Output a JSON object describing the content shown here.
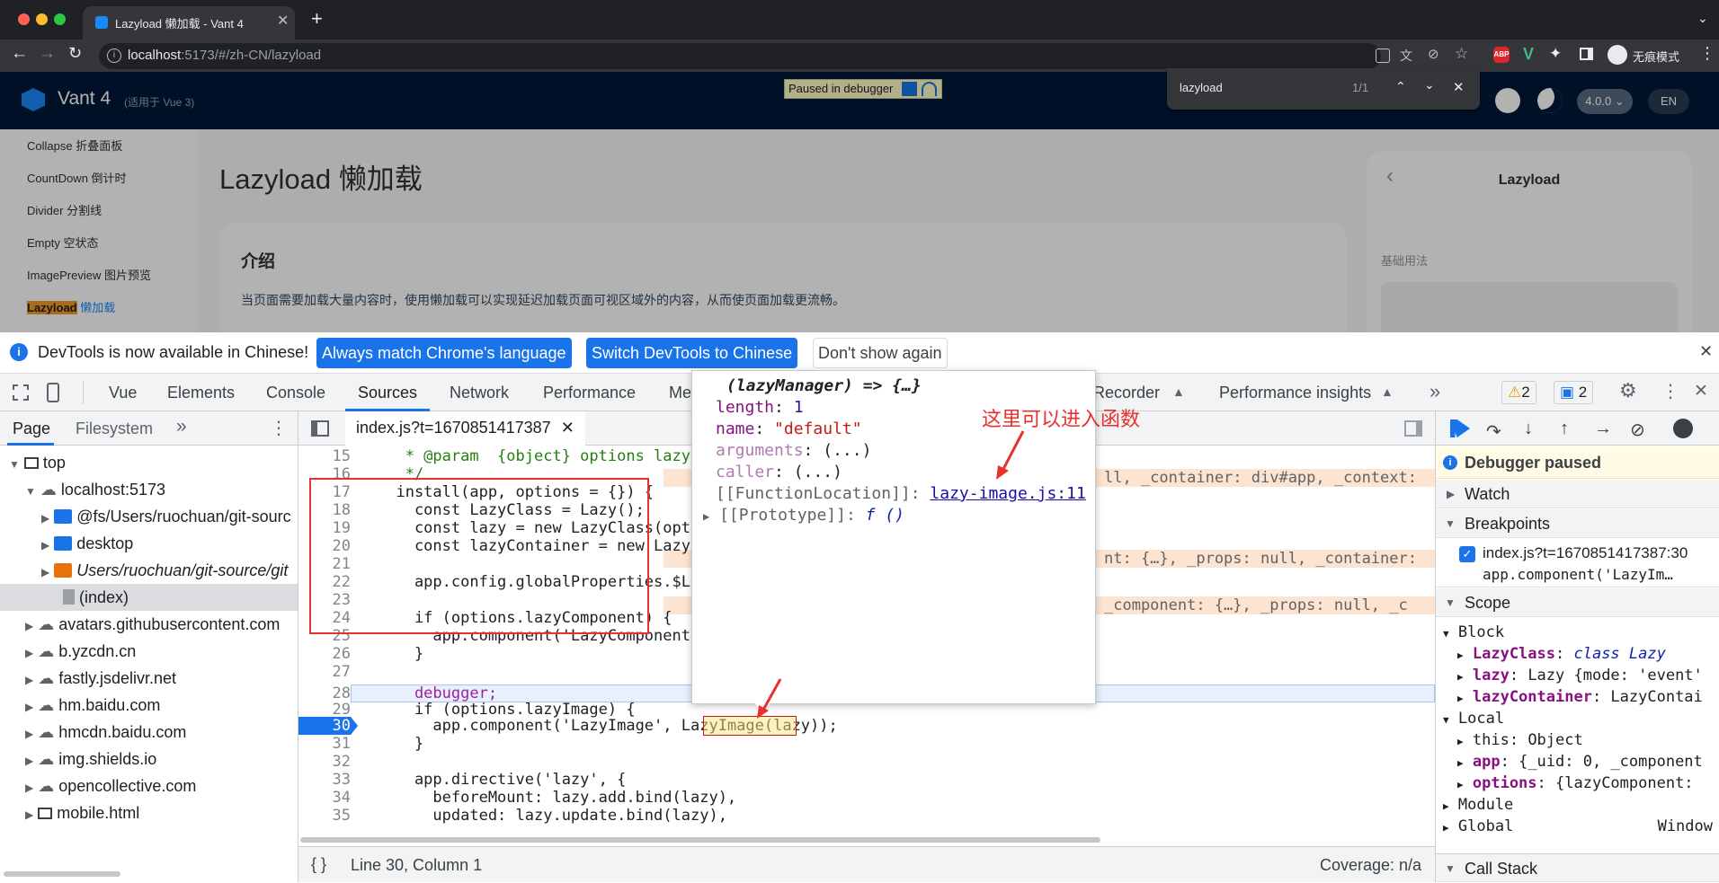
{
  "browser": {
    "tab_title": "Lazyload 懒加载 - Vant 4",
    "url_host": "localhost",
    "url_rest": ":5173/#/zh-CN/lazyload",
    "profile_label": "无痕模式"
  },
  "find_bar": {
    "query": "lazyload",
    "count": "1/1"
  },
  "page": {
    "debugger_badge": "Paused in debugger",
    "logo_name": "Vant 4",
    "logo_sub": "(适用于 Vue 3)",
    "version": "4.0.0",
    "lang": "EN",
    "nav": [
      "Collapse 折叠面板",
      "CountDown 倒计时",
      "Divider 分割线",
      "Empty 空状态",
      "ImagePreview 图片预览"
    ],
    "nav_active_a": "Lazyload",
    "nav_active_b": "懒加载",
    "title": "Lazyload 懒加载",
    "card_title": "介绍",
    "card_text": "当页面需要加载大量内容时，使用懒加载可以实现延迟加载页面可视区域外的内容，从而使页面加载更流畅。",
    "preview_title": "Lazyload",
    "preview_sub": "基础用法"
  },
  "infobar": {
    "text": "DevTools is now available in Chinese!",
    "btn1": "Always match Chrome's language",
    "btn2": "Switch DevTools to Chinese",
    "btn3": "Don't show again"
  },
  "devtabs": {
    "vue": "Vue",
    "elements": "Elements",
    "console": "Console",
    "sources": "Sources",
    "network": "Network",
    "performance": "Performance",
    "memory": "Me",
    "recorder": "Recorder",
    "perf_insights": "Performance insights",
    "warn_count": "2",
    "msg_count": "2"
  },
  "navigator": {
    "tab_page": "Page",
    "tab_fs": "Filesystem",
    "items": [
      "top",
      "localhost:5173",
      "@fs/Users/ruochuan/git-sourc",
      "desktop",
      "Users/ruochuan/git-source/git",
      "(index)",
      "avatars.githubusercontent.com",
      "b.yzcdn.cn",
      "fastly.jsdelivr.net",
      "hm.baidu.com",
      "hmcdn.baidu.com",
      "img.shields.io",
      "opencollective.com",
      "mobile.html"
    ]
  },
  "editor": {
    "file_tab": "index.js?t=1670851417387",
    "status_left": "Line 30, Column 1",
    "status_right": "Coverage: n/a",
    "lines": [
      {
        "n": "15",
        "t": "   * @param  {object} options lazy"
      },
      {
        "n": "16",
        "t": "   */"
      },
      {
        "n": "17",
        "t": "  install(app, options = {}) {  "
      },
      {
        "n": "18",
        "t": "    const LazyClass = Lazy();"
      },
      {
        "n": "19",
        "t": "    const lazy = new LazyClass(opt"
      },
      {
        "n": "20",
        "t": "    const lazyContainer = new Lazy"
      },
      {
        "n": "21",
        "t": ""
      },
      {
        "n": "22",
        "t": "    app.config.globalProperties.$L"
      },
      {
        "n": "23",
        "t": ""
      },
      {
        "n": "24",
        "t": "    if (options.lazyComponent) {  "
      },
      {
        "n": "25",
        "t": "      app.component('LazyComponent"
      },
      {
        "n": "26",
        "t": "    }"
      },
      {
        "n": "27",
        "t": ""
      },
      {
        "n": "28",
        "t": "    debugger;"
      },
      {
        "n": "29",
        "t": "    if (options.lazyImage) {"
      },
      {
        "n": "30",
        "t": "      app.component('LazyImage', LazyImage(lazy));"
      },
      {
        "n": "31",
        "t": "    }"
      },
      {
        "n": "32",
        "t": ""
      },
      {
        "n": "33",
        "t": "    app.directive('lazy', {"
      },
      {
        "n": "34",
        "t": "      beforeMount: lazy.add.bind(lazy),"
      },
      {
        "n": "35",
        "t": "      updated: lazy.update.bind(lazy),"
      }
    ],
    "inline_17": "ll, _container: div#app, _context:",
    "inline_22": "nt: {…}, _props: null, _container:",
    "inline_25": "_component: {…}, _props: null, _c"
  },
  "popup": {
    "header": "(lazyManager) => {…}",
    "length_key": "length",
    "length_val": "1",
    "name_key": "name",
    "name_val": "\"default\"",
    "args_key": "arguments",
    "args_val": "(...)",
    "caller_key": "caller",
    "caller_val": "(...)",
    "loc_key": "[[FunctionLocation]]:",
    "loc_link": "lazy-image.js:11",
    "proto_key": "[[Prototype]]:",
    "proto_val": "f ()"
  },
  "annotation": "这里可以进入函数",
  "debugger": {
    "paused": "Debugger paused",
    "watch": "Watch",
    "breakpoints": "Breakpoints",
    "bp_file": "index.js?t=1670851417387:30",
    "bp_code": "app.component('LazyIm…",
    "scope": "Scope",
    "block": "Block",
    "lazyclass_k": "LazyClass",
    "lazyclass_v": "class Lazy",
    "lazy_k": "lazy",
    "lazy_v": "Lazy {mode: 'event'",
    "lazycont_k": "lazyContainer",
    "lazycont_v": "LazyContai",
    "local": "Local",
    "this_k": "this",
    "this_v": "Object",
    "app_k": "app",
    "app_v": "{_uid: 0, _component",
    "options_k": "options",
    "options_v": "{lazyComponent: ",
    "module": "Module",
    "global": "Global",
    "global_v": "Window",
    "callstack": "Call Stack"
  },
  "colors": {
    "accent": "#1a73e8",
    "annotation": "#e8312f",
    "paused_bg": "#fffbe5"
  }
}
